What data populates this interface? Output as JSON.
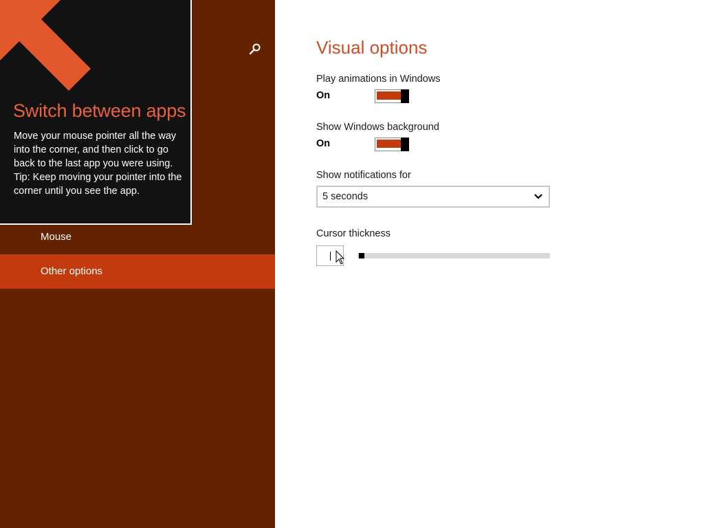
{
  "nav": {
    "items": [
      {
        "label": "Mouse",
        "selected": false
      },
      {
        "label": "Other options",
        "selected": true
      }
    ],
    "search_icon": "search-icon"
  },
  "tip": {
    "title": "Switch between apps",
    "body_lines": [
      "Move your mouse pointer all the way into the corner, and then click to go back to the last app you were using.",
      "Tip: Keep moving your pointer into the corner until you see the app."
    ],
    "arrow_icon": "arrow-up-left-icon"
  },
  "visual_options": {
    "title": "Visual options",
    "animations": {
      "label": "Play animations in Windows",
      "state": "On"
    },
    "background": {
      "label": "Show Windows background",
      "state": "On"
    },
    "notifications": {
      "label": "Show notifications for",
      "value": "5 seconds"
    },
    "cursor": {
      "label": "Cursor thickness",
      "value": 1
    }
  },
  "colors": {
    "nav_background": "#632300",
    "nav_selected": "#c23b0e",
    "accent_title": "#c8502a",
    "tip_background": "#121212",
    "tip_title": "#e8623a",
    "toggle_fill": "#c23b0e"
  }
}
